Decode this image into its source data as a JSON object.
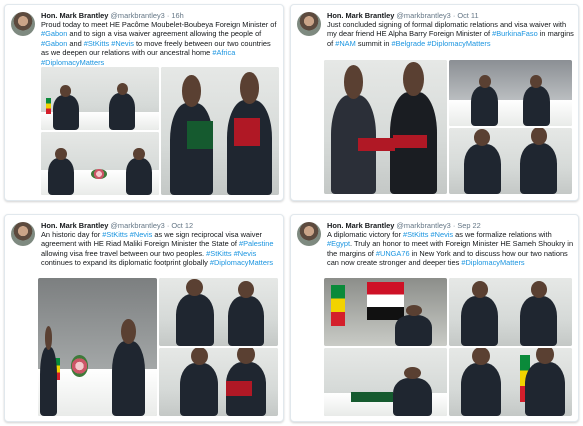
{
  "tweets": [
    {
      "name": "Hon. Mark Brantley",
      "handle": "@markbrantley3",
      "time": "· 16h",
      "parts": [
        {
          "t": "Proud today to meet HE Pacôme Moubelet-Boubeya Foreign Minister of ",
          "c": "text"
        },
        {
          "t": "#Gabon",
          "c": "tag"
        },
        {
          "t": " and to sign a visa waiver agreement allowing the people of ",
          "c": "text"
        },
        {
          "t": "#Gabon",
          "c": "tag"
        },
        {
          "t": " and ",
          "c": "text"
        },
        {
          "t": "#StKitts",
          "c": "tag"
        },
        {
          "t": " ",
          "c": "text"
        },
        {
          "t": "#Nevis",
          "c": "tag"
        },
        {
          "t": " to move freely between our two countries as we deepen our relations with our ancestral home ",
          "c": "text"
        },
        {
          "t": "#Africa",
          "c": "tag"
        },
        {
          "t": " ",
          "c": "text"
        },
        {
          "t": "#DiplomacyMatters",
          "c": "tag"
        }
      ],
      "photos": [
        "signing-at-table",
        "ministers-with-folders",
        "flowers-on-table",
        "exchange-of-documents"
      ]
    },
    {
      "name": "Hon. Mark Brantley",
      "handle": "@markbrantley3",
      "time": "· Oct 11",
      "parts": [
        {
          "t": "Just concluded signing of formal diplomatic relations and visa waiver with my dear friend HE Alpha Barry Foreign Minister of ",
          "c": "text"
        },
        {
          "t": "#BurkinaFaso",
          "c": "tag"
        },
        {
          "t": " in margins of ",
          "c": "text"
        },
        {
          "t": "#NAM",
          "c": "tag"
        },
        {
          "t": " summit in ",
          "c": "text"
        },
        {
          "t": "#Belgrade",
          "c": "tag"
        },
        {
          "t": " ",
          "c": "text"
        },
        {
          "t": "#DiplomacyMatters",
          "c": "tag"
        }
      ],
      "photos": [
        "exchange-of-red-folders",
        "ministers-seated",
        "handshake"
      ]
    },
    {
      "name": "Hon. Mark Brantley",
      "handle": "@markbrantley3",
      "time": "· Oct 12",
      "parts": [
        {
          "t": "An historic day for ",
          "c": "text"
        },
        {
          "t": "#StKitts",
          "c": "tag"
        },
        {
          "t": " ",
          "c": "text"
        },
        {
          "t": "#Nevis",
          "c": "tag"
        },
        {
          "t": " as we sign reciprocal visa waiver agreement with HE Riad Maliki Foreign Minister the State of ",
          "c": "text"
        },
        {
          "t": "#Palestine",
          "c": "tag"
        },
        {
          "t": " allowing visa free travel between our two peoples. ",
          "c": "text"
        },
        {
          "t": "#StKitts",
          "c": "tag"
        },
        {
          "t": " ",
          "c": "text"
        },
        {
          "t": "#Nevis",
          "c": "tag"
        },
        {
          "t": " continues to expand its diplomatic footprint globally ",
          "c": "text"
        },
        {
          "t": "#DiplomacyMatters",
          "c": "tag"
        }
      ],
      "photos": [
        "signing-with-flags",
        "ministers-standing",
        "minister-portrait",
        "handshake-with-folders"
      ]
    },
    {
      "name": "Hon. Mark Brantley",
      "handle": "@markbrantley3",
      "time": "· Sep 22",
      "parts": [
        {
          "t": "A diplomatic victory for ",
          "c": "text"
        },
        {
          "t": "#StKitts",
          "c": "tag"
        },
        {
          "t": " ",
          "c": "text"
        },
        {
          "t": "#Nevis",
          "c": "tag"
        },
        {
          "t": " as we formalize relations with ",
          "c": "text"
        },
        {
          "t": "#Egypt",
          "c": "tag"
        },
        {
          "t": ". Truly an honor to meet with Foreign Minister HE Sameh Shoukry in the margins of ",
          "c": "text"
        },
        {
          "t": "#UNGA76",
          "c": "tag"
        },
        {
          "t": " in New York and to discuss how our two nations can now create stronger and deeper ties ",
          "c": "text"
        },
        {
          "t": "#DiplomacyMatters",
          "c": "tag"
        }
      ],
      "photos": [
        "egypt-flag-signing",
        "ministers-meeting",
        "signing-at-desk",
        "handshake-with-flags"
      ]
    }
  ],
  "colors": {
    "hashtag": "#1b95e0",
    "text": "#14171a",
    "muted": "#657786"
  }
}
